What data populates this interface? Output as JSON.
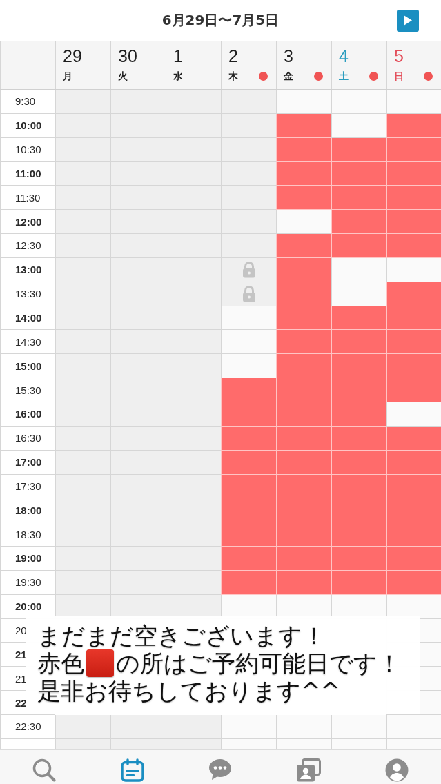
{
  "header": {
    "title": "6月29日〜7月5日"
  },
  "days": [
    {
      "date": "29",
      "weekday": "月",
      "kind": "weekday",
      "marked": false
    },
    {
      "date": "30",
      "weekday": "火",
      "kind": "weekday",
      "marked": false
    },
    {
      "date": "1",
      "weekday": "水",
      "kind": "weekday",
      "marked": false
    },
    {
      "date": "2",
      "weekday": "木",
      "kind": "weekday",
      "marked": true
    },
    {
      "date": "3",
      "weekday": "金",
      "kind": "weekday",
      "marked": true
    },
    {
      "date": "4",
      "weekday": "土",
      "kind": "saturday",
      "marked": true
    },
    {
      "date": "5",
      "weekday": "日",
      "kind": "sunday",
      "marked": true
    }
  ],
  "rows": [
    {
      "time": "9:30",
      "kind": "half",
      "cells": [
        {
          "kind": "closed"
        },
        {
          "kind": "closed"
        },
        {
          "kind": "closed"
        },
        {
          "kind": "closed"
        },
        {
          "kind": "empty"
        },
        {
          "kind": "empty"
        },
        {
          "kind": "empty"
        }
      ]
    },
    {
      "time": "10:00",
      "kind": "hour",
      "cells": [
        {
          "kind": "closed"
        },
        {
          "kind": "closed"
        },
        {
          "kind": "closed"
        },
        {
          "kind": "closed"
        },
        {
          "kind": "open"
        },
        {
          "kind": "empty"
        },
        {
          "kind": "open"
        }
      ]
    },
    {
      "time": "10:30",
      "kind": "half",
      "cells": [
        {
          "kind": "closed"
        },
        {
          "kind": "closed"
        },
        {
          "kind": "closed"
        },
        {
          "kind": "closed"
        },
        {
          "kind": "open"
        },
        {
          "kind": "open"
        },
        {
          "kind": "open"
        }
      ]
    },
    {
      "time": "11:00",
      "kind": "hour",
      "cells": [
        {
          "kind": "closed"
        },
        {
          "kind": "closed"
        },
        {
          "kind": "closed"
        },
        {
          "kind": "closed"
        },
        {
          "kind": "open"
        },
        {
          "kind": "open"
        },
        {
          "kind": "open"
        }
      ]
    },
    {
      "time": "11:30",
      "kind": "half",
      "cells": [
        {
          "kind": "closed"
        },
        {
          "kind": "closed"
        },
        {
          "kind": "closed"
        },
        {
          "kind": "closed"
        },
        {
          "kind": "open"
        },
        {
          "kind": "open"
        },
        {
          "kind": "open"
        }
      ]
    },
    {
      "time": "12:00",
      "kind": "hour",
      "cells": [
        {
          "kind": "closed"
        },
        {
          "kind": "closed"
        },
        {
          "kind": "closed"
        },
        {
          "kind": "closed"
        },
        {
          "kind": "empty"
        },
        {
          "kind": "open"
        },
        {
          "kind": "open"
        }
      ]
    },
    {
      "time": "12:30",
      "kind": "half",
      "cells": [
        {
          "kind": "closed"
        },
        {
          "kind": "closed"
        },
        {
          "kind": "closed"
        },
        {
          "kind": "closed"
        },
        {
          "kind": "open"
        },
        {
          "kind": "open"
        },
        {
          "kind": "open"
        }
      ]
    },
    {
      "time": "13:00",
      "kind": "hour",
      "cells": [
        {
          "kind": "closed"
        },
        {
          "kind": "closed"
        },
        {
          "kind": "closed"
        },
        {
          "kind": "locked"
        },
        {
          "kind": "open"
        },
        {
          "kind": "empty"
        },
        {
          "kind": "empty"
        }
      ]
    },
    {
      "time": "13:30",
      "kind": "half",
      "cells": [
        {
          "kind": "closed"
        },
        {
          "kind": "closed"
        },
        {
          "kind": "closed"
        },
        {
          "kind": "locked"
        },
        {
          "kind": "open"
        },
        {
          "kind": "empty"
        },
        {
          "kind": "open"
        }
      ]
    },
    {
      "time": "14:00",
      "kind": "hour",
      "cells": [
        {
          "kind": "closed"
        },
        {
          "kind": "closed"
        },
        {
          "kind": "closed"
        },
        {
          "kind": "empty"
        },
        {
          "kind": "open"
        },
        {
          "kind": "open"
        },
        {
          "kind": "open"
        }
      ]
    },
    {
      "time": "14:30",
      "kind": "half",
      "cells": [
        {
          "kind": "closed"
        },
        {
          "kind": "closed"
        },
        {
          "kind": "closed"
        },
        {
          "kind": "empty"
        },
        {
          "kind": "open"
        },
        {
          "kind": "open"
        },
        {
          "kind": "open"
        }
      ]
    },
    {
      "time": "15:00",
      "kind": "hour",
      "cells": [
        {
          "kind": "closed"
        },
        {
          "kind": "closed"
        },
        {
          "kind": "closed"
        },
        {
          "kind": "empty"
        },
        {
          "kind": "open"
        },
        {
          "kind": "open"
        },
        {
          "kind": "open"
        }
      ]
    },
    {
      "time": "15:30",
      "kind": "half",
      "cells": [
        {
          "kind": "closed"
        },
        {
          "kind": "closed"
        },
        {
          "kind": "closed"
        },
        {
          "kind": "open"
        },
        {
          "kind": "open"
        },
        {
          "kind": "open"
        },
        {
          "kind": "open"
        }
      ]
    },
    {
      "time": "16:00",
      "kind": "hour",
      "cells": [
        {
          "kind": "closed"
        },
        {
          "kind": "closed"
        },
        {
          "kind": "closed"
        },
        {
          "kind": "open"
        },
        {
          "kind": "open"
        },
        {
          "kind": "open"
        },
        {
          "kind": "empty"
        }
      ]
    },
    {
      "time": "16:30",
      "kind": "half",
      "cells": [
        {
          "kind": "closed"
        },
        {
          "kind": "closed"
        },
        {
          "kind": "closed"
        },
        {
          "kind": "open"
        },
        {
          "kind": "open"
        },
        {
          "kind": "open"
        },
        {
          "kind": "open"
        }
      ]
    },
    {
      "time": "17:00",
      "kind": "hour",
      "cells": [
        {
          "kind": "closed"
        },
        {
          "kind": "closed"
        },
        {
          "kind": "closed"
        },
        {
          "kind": "open"
        },
        {
          "kind": "open"
        },
        {
          "kind": "open"
        },
        {
          "kind": "open"
        }
      ]
    },
    {
      "time": "17:30",
      "kind": "half",
      "cells": [
        {
          "kind": "closed"
        },
        {
          "kind": "closed"
        },
        {
          "kind": "closed"
        },
        {
          "kind": "open"
        },
        {
          "kind": "open"
        },
        {
          "kind": "open"
        },
        {
          "kind": "open"
        }
      ]
    },
    {
      "time": "18:00",
      "kind": "hour",
      "cells": [
        {
          "kind": "closed"
        },
        {
          "kind": "closed"
        },
        {
          "kind": "closed"
        },
        {
          "kind": "open"
        },
        {
          "kind": "open"
        },
        {
          "kind": "open"
        },
        {
          "kind": "open"
        }
      ]
    },
    {
      "time": "18:30",
      "kind": "half",
      "cells": [
        {
          "kind": "closed"
        },
        {
          "kind": "closed"
        },
        {
          "kind": "closed"
        },
        {
          "kind": "open"
        },
        {
          "kind": "open"
        },
        {
          "kind": "open"
        },
        {
          "kind": "open"
        }
      ]
    },
    {
      "time": "19:00",
      "kind": "hour",
      "cells": [
        {
          "kind": "closed"
        },
        {
          "kind": "closed"
        },
        {
          "kind": "closed"
        },
        {
          "kind": "open"
        },
        {
          "kind": "open"
        },
        {
          "kind": "open"
        },
        {
          "kind": "open"
        }
      ]
    },
    {
      "time": "19:30",
      "kind": "half",
      "cells": [
        {
          "kind": "closed"
        },
        {
          "kind": "closed"
        },
        {
          "kind": "closed"
        },
        {
          "kind": "open"
        },
        {
          "kind": "open"
        },
        {
          "kind": "open"
        },
        {
          "kind": "open"
        }
      ]
    },
    {
      "time": "20:00",
      "kind": "hour",
      "cells": [
        {
          "kind": "closed"
        },
        {
          "kind": "closed"
        },
        {
          "kind": "closed"
        },
        {
          "kind": "empty"
        },
        {
          "kind": "empty"
        },
        {
          "kind": "empty"
        },
        {
          "kind": "empty"
        }
      ]
    },
    {
      "time": "20",
      "kind": "half",
      "cells": [
        {
          "kind": "empty"
        }
      ]
    },
    {
      "time": "21",
      "kind": "hour",
      "cells": [
        {
          "kind": "empty"
        }
      ]
    },
    {
      "time": "21",
      "kind": "half",
      "cells": [
        {
          "kind": "empty"
        }
      ]
    },
    {
      "time": "22",
      "kind": "hour",
      "cells": [
        {
          "kind": "empty"
        }
      ]
    },
    {
      "time": "22:30",
      "kind": "half",
      "cells": [
        {
          "kind": "closed"
        },
        {
          "kind": "closed"
        },
        {
          "kind": "closed"
        },
        {
          "kind": "empty"
        },
        {
          "kind": "empty"
        },
        {
          "kind": "empty"
        },
        {
          "kind": "empty"
        }
      ]
    },
    {
      "cells": [
        {
          "kind": "closed"
        },
        {
          "kind": "closed"
        },
        {
          "kind": "closed"
        },
        {
          "kind": "empty"
        },
        {
          "kind": "empty"
        },
        {
          "kind": "empty"
        },
        {
          "kind": "empty"
        }
      ]
    }
  ],
  "caption": {
    "lines": [
      {
        "parts": [
          {
            "kind": "text",
            "text": "まだまだ空きございます！"
          }
        ]
      },
      {
        "parts": [
          {
            "kind": "text",
            "text": "赤色"
          },
          {
            "kind": "swatch"
          },
          {
            "kind": "text",
            "text": "の所はご予約可能日です！"
          }
        ]
      },
      {
        "parts": [
          {
            "kind": "text",
            "text": "是非お待ちしております^^"
          }
        ]
      }
    ]
  },
  "nav": [
    {
      "kind": "search",
      "selected": false
    },
    {
      "kind": "calendar",
      "selected": true
    },
    {
      "kind": "chat",
      "selected": false
    },
    {
      "kind": "photos",
      "selected": false
    },
    {
      "kind": "profile",
      "selected": false
    }
  ]
}
